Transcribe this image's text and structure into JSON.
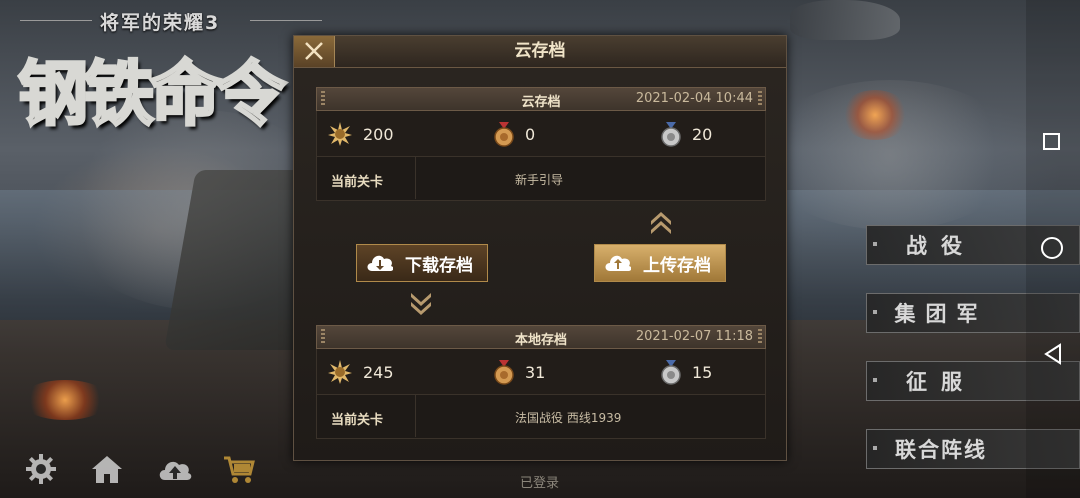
{
  "logo": {
    "subtitle": "将军的荣耀3",
    "title": "钢铁命令"
  },
  "dialog": {
    "title": "云存档",
    "cloud": {
      "header": "云存档",
      "date": "2021-02-04 10:44",
      "gold_medal": "200",
      "bronze_medal": "0",
      "silver_medal": "20",
      "level_label": "当前关卡",
      "level_value": "新手引导"
    },
    "local": {
      "header": "本地存档",
      "date": "2021-02-07  11:18",
      "gold_medal": "245",
      "bronze_medal": "31",
      "silver_medal": "15",
      "level_label": "当前关卡",
      "level_value": "法国战役  西线1939"
    },
    "download_label": "下载存档",
    "upload_label": "上传存档"
  },
  "right_menu": [
    {
      "label": "战役"
    },
    {
      "label": "集团军"
    },
    {
      "label": "征服"
    },
    {
      "label": "联合阵线"
    }
  ],
  "bottom": {
    "status": "已登录"
  },
  "icons": {
    "bottom": [
      "gear-icon",
      "home-icon",
      "cloud-upload-icon",
      "shopping-cart-icon"
    ],
    "nav": [
      "recent-apps-icon",
      "home-nav-icon",
      "back-icon"
    ]
  },
  "colors": {
    "accent": "#c9a060",
    "cart": "#c89a3a"
  }
}
